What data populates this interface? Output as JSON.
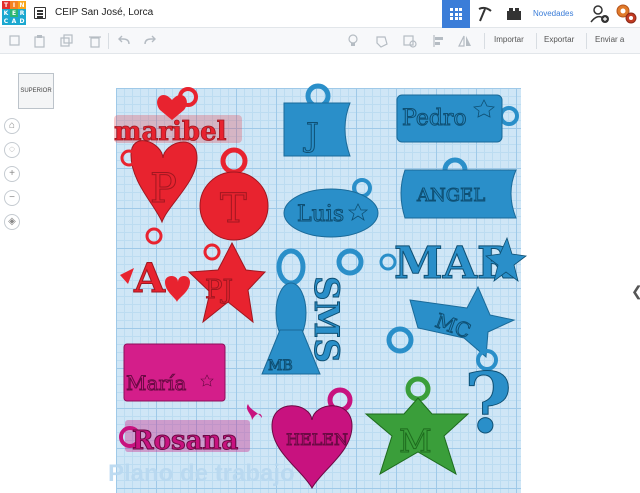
{
  "app": {
    "logo_letters": [
      "TIN",
      "KER",
      "CAD"
    ],
    "logo_colors": [
      "#e2302c",
      "#f58220",
      "#faa61a",
      "#1ba8d0",
      "#2bb673",
      "#1ba8d0",
      "#1ba8d0",
      "#1ba8d0",
      "#1ba8d0"
    ],
    "design_title": "CEIP San José, Lorca",
    "news_label": "Novedades"
  },
  "toolbar": {
    "import_label": "Importar",
    "export_label": "Exportar",
    "send_label": "Enviar a"
  },
  "viewcube": {
    "label": "SUPERIOR"
  },
  "workplane": {
    "label": "Plano de trabajo"
  },
  "shapes": {
    "names": [
      "maribel",
      "P",
      "T",
      "J",
      "Pedro",
      "Luis",
      "ANGEL",
      "A",
      "PJ",
      "MB",
      "SMS",
      "MAR",
      "MC",
      "María",
      "Rosana",
      "HELEN",
      "M",
      "?"
    ]
  },
  "colors": {
    "accent": "#3b7dd8",
    "red": "#e8232f",
    "blue": "#2a8fc9",
    "magenta": "#c8127f",
    "green": "#3a9e3a"
  }
}
